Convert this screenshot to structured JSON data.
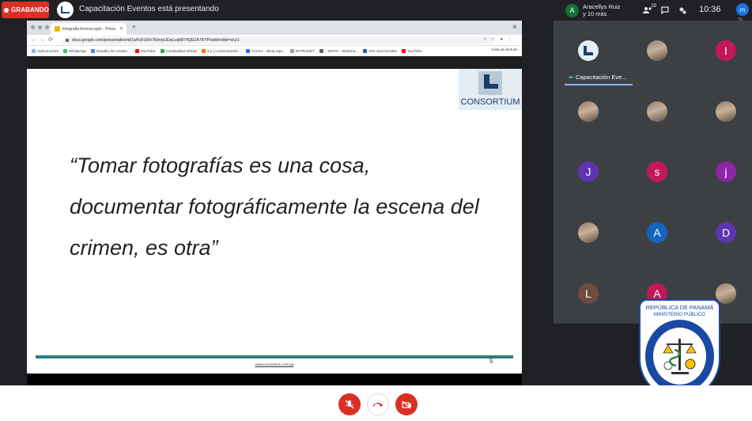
{
  "recording": {
    "label": "GRABANDO"
  },
  "presenting": {
    "text": "Capacitación Eventos está presentando"
  },
  "people": {
    "initial": "A",
    "line1": "Aracellys Ruiz",
    "line2": "y 10 más",
    "count": "29"
  },
  "clock": "10:36",
  "me": {
    "initial": "m",
    "label": "Tú"
  },
  "browser": {
    "tab_title": "fotografia forense.pptx - Prese",
    "url": "docs.google.com/presentation/d/1wFxFUt0v7b0rrpUDaLuqWl74QE1A7KYP/edit#slide=id.p1",
    "bookmarks": [
      "Aplicaciones",
      "WhatsApp",
      "Estudio de creado...",
      "YouTube",
      "Creatividad Virtual",
      "3.2 | Comenzando...",
      "Correo - silvia.roja...",
      "INTRANET",
      ":::SPOA - Sistema...",
      "SIG Seccionales",
      "YouTube"
    ],
    "bookmark_more": "Lista de lectura"
  },
  "slide": {
    "logo": "CONSORTIUM",
    "quote_lines": [
      "“Tomar fotografías es una cosa,",
      "documentar fotográficamente la escena del",
      "crimen, es otra”"
    ],
    "footer_url": "www.consortium.com.pa",
    "page_number": "5"
  },
  "participants": [
    {
      "kind": "logo",
      "label": "Capacitación Eve..."
    },
    {
      "kind": "photo"
    },
    {
      "kind": "letter",
      "initial": "I",
      "color": "#c2185b"
    },
    {
      "kind": "photo"
    },
    {
      "kind": "photo"
    },
    {
      "kind": "photo"
    },
    {
      "kind": "letter",
      "initial": "J",
      "color": "#5e35b1"
    },
    {
      "kind": "letter",
      "initial": "s",
      "color": "#c2185b"
    },
    {
      "kind": "letter",
      "initial": "j",
      "color": "#8e24aa"
    },
    {
      "kind": "photo"
    },
    {
      "kind": "letter",
      "initial": "A",
      "color": "#1565c0"
    },
    {
      "kind": "letter",
      "initial": "D",
      "color": "#5e35b1"
    },
    {
      "kind": "letter",
      "initial": "L",
      "color": "#6d4c41"
    },
    {
      "kind": "letter",
      "initial": "A",
      "color": "#c2185b"
    },
    {
      "kind": "photo"
    }
  ],
  "seal": {
    "line1": "REPÚBLICA DE PANAMÁ",
    "line2": "MINISTERIO PÚBLICO",
    "ring_text": "INSTITUTO DE MEDICINA LEGAL Y CIENCIAS FORENSES"
  },
  "controls": {
    "mic": "mic-off-icon",
    "end": "end-call-icon",
    "camera": "camera-off-icon"
  },
  "colors": {
    "record": "#d93025",
    "accent": "#2e7d7c",
    "panel": "#3c4043"
  }
}
